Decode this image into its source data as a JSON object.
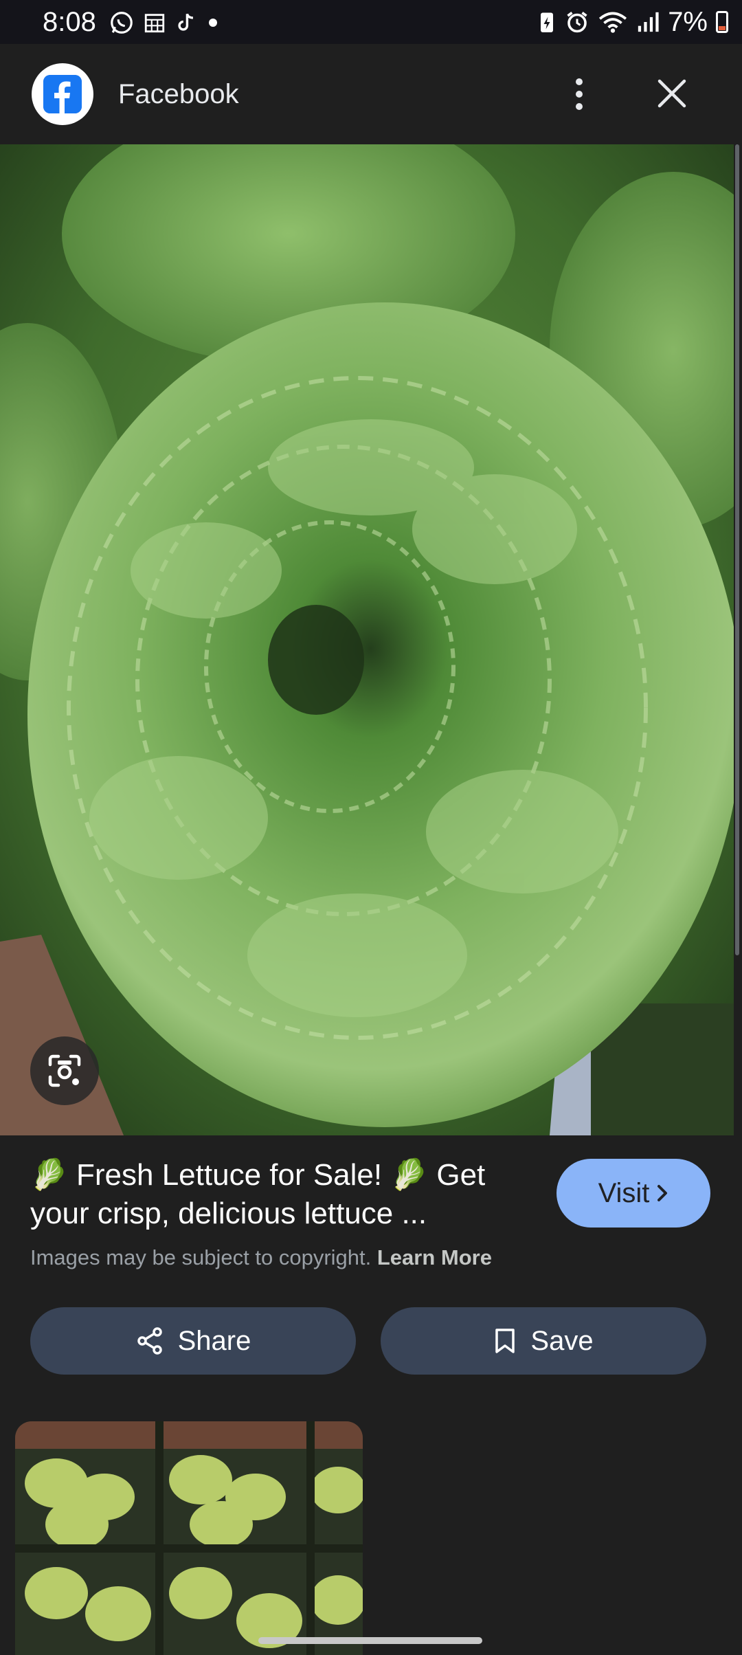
{
  "status_bar": {
    "time": "8:08",
    "battery_percent": "7%",
    "left_icons": [
      "whatsapp-icon",
      "calendar-icon",
      "tiktok-icon",
      "dot-icon"
    ],
    "right_icons": [
      "battery-saver-icon",
      "alarm-icon",
      "wifi-icon",
      "signal-icon",
      "battery-icon"
    ]
  },
  "header": {
    "source_logo": "facebook-logo",
    "source_name": "Facebook"
  },
  "result": {
    "title": "🥬 Fresh Lettuce for Sale! 🥬 Get your crisp, delicious lettuce ...",
    "visit_label": "Visit",
    "copyright_text": "Images may be subject to copyright.",
    "learn_more_label": "Learn More",
    "share_label": "Share",
    "save_label": "Save"
  },
  "colors": {
    "background": "#1f1f1f",
    "visit_button": "#8ab4f8",
    "action_button": "#394457",
    "facebook_blue": "#1877f2"
  }
}
